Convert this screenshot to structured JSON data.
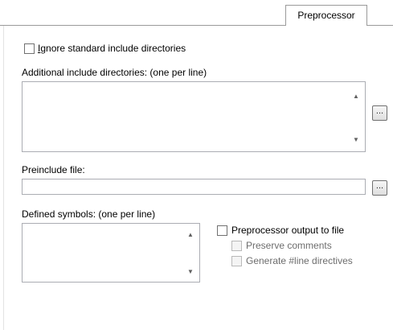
{
  "tabs": {
    "active_label": "Preprocessor"
  },
  "ignore_std": {
    "label": "Ignore standard include directories",
    "accesskey": "I",
    "checked": false
  },
  "include_dirs": {
    "label": "Additional include directories: (one per line)",
    "accesskey": "A",
    "value": "",
    "browse_label": "..."
  },
  "preinclude": {
    "label": "Preinclude file:",
    "value": "",
    "browse_label": "..."
  },
  "defined_symbols": {
    "label": "Defined symbols: (one per line)",
    "value": ""
  },
  "preproc_output": {
    "label": "Preprocessor output to file",
    "checked": false
  },
  "preserve_comments": {
    "label": "Preserve comments",
    "checked": false,
    "enabled": false
  },
  "generate_line": {
    "label": "Generate #line directives",
    "checked": false,
    "enabled": false
  },
  "icons": {
    "scroll_up": "▲",
    "scroll_down": "▼"
  }
}
